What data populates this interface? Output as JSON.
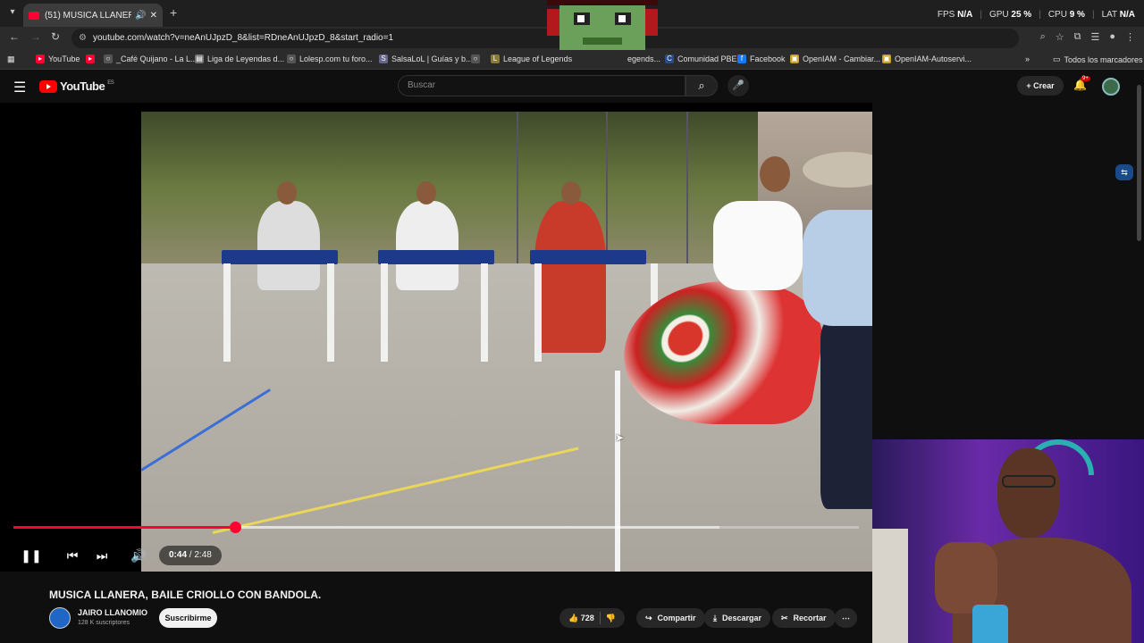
{
  "browser": {
    "tab_title": "(51) MUSICA LLANERA, BAILE",
    "url": "youtube.com/watch?v=neAnUJpzD_8&list=RDneAnUJpzD_8&start_radio=1",
    "perf": {
      "fps_label": "FPS",
      "fps_value": "N/A",
      "gpu_label": "GPU",
      "gpu_value": "25 %",
      "cpu_label": "CPU",
      "cpu_value": "9 %",
      "lat_label": "LAT",
      "lat_value": "N/A"
    },
    "bookmarks": [
      {
        "label": "YouTube",
        "icon": "youtube-icon",
        "color": "#ff0033"
      },
      {
        "label": "",
        "icon": "youtube-icon",
        "color": "#ff0033"
      },
      {
        "label": "_Café Quijano - La L...",
        "icon": "globe-icon",
        "color": "#555555"
      },
      {
        "label": "Liga de Leyendas d...",
        "icon": "page-icon",
        "color": "#777777"
      },
      {
        "label": "Lolesp.com tu foro...",
        "icon": "globe-icon",
        "color": "#555555"
      },
      {
        "label": "SalsaLoL | Guías y b...",
        "icon": "s-icon",
        "color": "#666688"
      },
      {
        "label": "",
        "icon": "globe-icon",
        "color": "#555555"
      },
      {
        "label": "League of Legends",
        "icon": "lol-icon",
        "color": "#8a7a3a"
      },
      {
        "label": "egends...",
        "icon": "page-icon",
        "color": "#555555"
      },
      {
        "label": "Comunidad PBE",
        "icon": "c-icon",
        "color": "#2a4a8a"
      },
      {
        "label": "Facebook",
        "icon": "facebook-icon",
        "color": "#1877f2"
      },
      {
        "label": "OpenIAM - Cambiar...",
        "icon": "openiam-icon",
        "color": "#c8a020"
      },
      {
        "label": "OpenIAM-Autoservi...",
        "icon": "openiam-icon",
        "color": "#c8a020"
      }
    ],
    "all_bookmarks": "Todos los marcadores"
  },
  "youtube": {
    "logo_text": "YouTube",
    "logo_region": "ES",
    "search_placeholder": "Buscar",
    "create_label": "Crear",
    "notif_count": "9+"
  },
  "player": {
    "current_time": "0:44",
    "duration": "2:48",
    "progress_fraction": 0.262,
    "buffered_fraction": 0.835
  },
  "video": {
    "title": "MUSICA LLANERA, BAILE CRIOLLO CON BANDOLA.",
    "channel_name": "JAIRO LLANOMIO",
    "subscribers": "128 K suscriptores",
    "subscribe_label": "Suscribirme",
    "likes": "728",
    "share_label": "Compartir",
    "download_label": "Descargar",
    "clip_label": "Recortar"
  },
  "colors": {
    "accent": "#ff0033",
    "background": "#0f0f0f"
  }
}
